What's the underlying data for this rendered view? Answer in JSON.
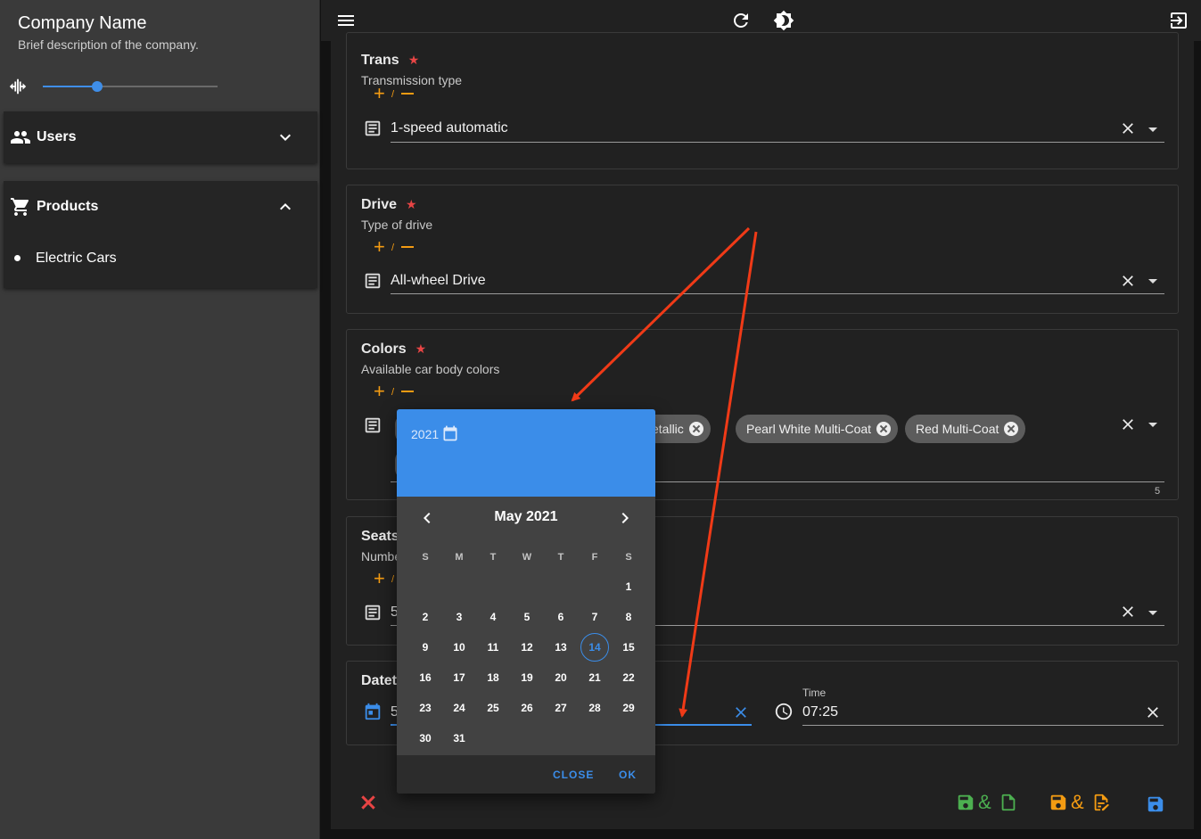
{
  "sidebar": {
    "company_name": "Company Name",
    "company_desc": "Brief description of the company.",
    "width_slider_fraction": 0.31,
    "nav": [
      {
        "label": "Users",
        "icon": "users-icon",
        "expanded": false
      },
      {
        "label": "Products",
        "icon": "cart-icon",
        "expanded": true,
        "children": [
          "Electric Cars"
        ]
      }
    ]
  },
  "topbar": {
    "icons": [
      "menu-icon",
      "refresh-icon",
      "brightness-icon",
      "logout-icon"
    ]
  },
  "fields": {
    "trans": {
      "title": "Trans",
      "desc": "Transmission type",
      "value": "1-speed automatic"
    },
    "drive": {
      "title": "Drive",
      "desc": "Type of drive",
      "value": "All-wheel Drive"
    },
    "colors": {
      "title": "Colors",
      "desc": "Available car body colors",
      "chips": [
        "etallic",
        "Pearl White Multi-Coat",
        "Red Multi-Coat"
      ],
      "count": "5"
    },
    "seats": {
      "title": "Seats",
      "desc": "Numbe",
      "value": "5"
    },
    "datetime": {
      "title": "Datet",
      "date_value": "5",
      "time_label": "Time",
      "time_value": "07:25"
    }
  },
  "plusminus": {
    "plus": "+",
    "slash": "/"
  },
  "star": "★",
  "datepicker": {
    "year": "2021",
    "month_label": "May 2021",
    "weekdays": [
      "S",
      "M",
      "T",
      "W",
      "T",
      "F",
      "S"
    ],
    "first_weekday_index": 6,
    "days_in_month": 31,
    "selected_day": 14,
    "close_label": "CLOSE",
    "ok_label": "OK"
  },
  "colors": {
    "accent_blue": "#3b8de9",
    "orange": "#f39b12",
    "red": "#e84545",
    "green": "#4caf50",
    "arrow_red": "#f03a17"
  }
}
